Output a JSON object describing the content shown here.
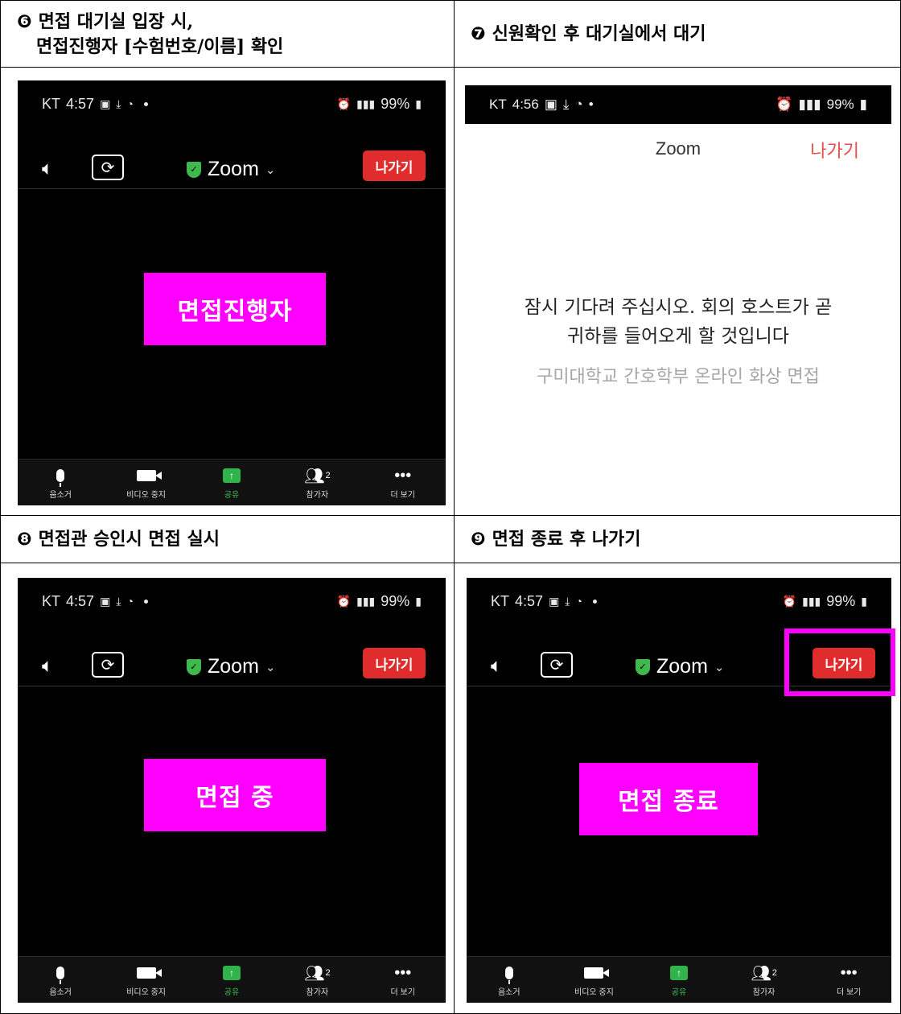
{
  "steps": [
    {
      "num": "❻",
      "title_line1": "면접 대기실 입장 시,",
      "title_line2": "면접진행자 [수험번호/이름] 확인",
      "box_label": "면접진행자"
    },
    {
      "num": "❼",
      "title_line1": "신원확인 후 대기실에서 대기",
      "title_line2": ""
    },
    {
      "num": "❽",
      "title_line1": "면접관 승인시 면접 실시",
      "title_line2": "",
      "box_label": "면접 중"
    },
    {
      "num": "❾",
      "title_line1": "면접 종료 후 나가기",
      "title_line2": "",
      "box_label": "면접 종료"
    }
  ],
  "phone": {
    "carrier": "KT",
    "time": "4:57",
    "battery": "99%",
    "app_title": "Zoom",
    "leave_label": "나가기",
    "bottom": {
      "mute": "음소거",
      "video": "비디오 중지",
      "share": "공유",
      "participants": "참가자",
      "participants_count": "2",
      "more": "더 보기"
    },
    "icons": [
      "speaker-icon",
      "camera-switch-icon",
      "shield-icon",
      "chevron-down-icon",
      "mic-icon",
      "video-icon",
      "share-icon",
      "participants-icon",
      "more-icon"
    ],
    "colors": {
      "leave": "#e02c2c",
      "share": "#2fb34a",
      "shield": "#3fb94e",
      "highlight": "#ff00ff"
    }
  },
  "waiting": {
    "carrier": "KT",
    "time": "4:56",
    "battery": "99%",
    "title": "Zoom",
    "leave_label": "나가기",
    "message_line1": "잠시 기다려 주십시오. 회의 호스트가 곧",
    "message_line2": "귀하를 들어오게 할 것입니다",
    "meeting_name": "구미대학교 간호학부 온라인 화상 면접"
  }
}
